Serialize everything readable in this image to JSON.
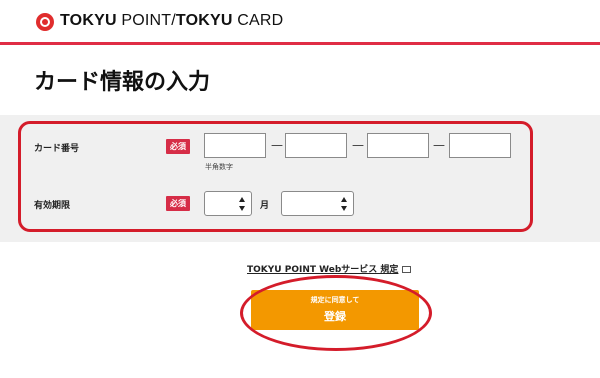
{
  "header": {
    "brand_bold1": "TOKYU",
    "brand_thin1": " POINT",
    "brand_sep": "/",
    "brand_bold2": "TOKYU",
    "brand_thin2": " CARD",
    "logo_icon": "tokyu-logo-mark",
    "accent_color": "#e02d45"
  },
  "page": {
    "title": "カード情報の入力"
  },
  "form": {
    "card_number": {
      "label": "カード番号",
      "required": "必須",
      "separator": "—",
      "hint": "半角数字",
      "values": [
        "",
        "",
        "",
        ""
      ]
    },
    "expiry": {
      "label": "有効期限",
      "required": "必須",
      "month_value": "",
      "month_unit": "月",
      "year_value": ""
    }
  },
  "terms": {
    "link_text": "TOKYU POINT Webサービス 規定",
    "icon": "external-window-icon"
  },
  "submit": {
    "sub_label": "規定に同意して",
    "label": "登録",
    "color": "#f39800"
  },
  "annotations": {
    "color": "#d41c2a"
  }
}
